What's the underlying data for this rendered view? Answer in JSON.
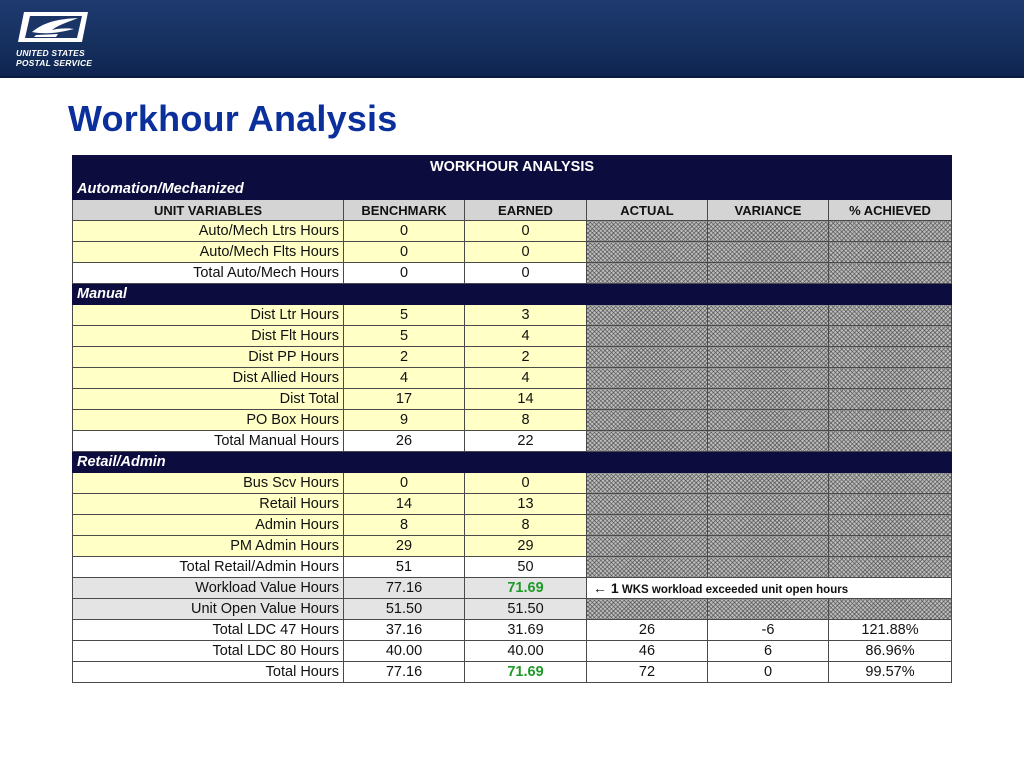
{
  "header": {
    "logo_line1": "UNITED STATES",
    "logo_line2": "POSTAL SERVICE",
    "slide_title": "Workhour Analysis"
  },
  "colors": {
    "banner": "#1a3566",
    "title": "#0b2f9b",
    "table_header": "#0c0c3e",
    "yellow_cell": "#ffffc6",
    "green_value": "#1e9a28"
  },
  "table": {
    "title": "WORKHOUR ANALYSIS",
    "columns": [
      "UNIT VARIABLES",
      "BENCHMARK",
      "EARNED",
      "ACTUAL",
      "VARIANCE",
      "% ACHIEVED"
    ],
    "sections": {
      "auto": "Automation/Mechanized",
      "manual": "Manual",
      "retail": "Retail/Admin"
    },
    "rows": {
      "auto_ltrs": {
        "label": "Auto/Mech Ltrs Hours",
        "benchmark": "0",
        "earned": "0"
      },
      "auto_flts": {
        "label": "Auto/Mech Flts Hours",
        "benchmark": "0",
        "earned": "0"
      },
      "auto_total": {
        "label": "Total Auto/Mech Hours",
        "benchmark": "0",
        "earned": "0"
      },
      "dist_ltr": {
        "label": "Dist Ltr Hours",
        "benchmark": "5",
        "earned": "3"
      },
      "dist_flt": {
        "label": "Dist Flt Hours",
        "benchmark": "5",
        "earned": "4"
      },
      "dist_pp": {
        "label": "Dist PP Hours",
        "benchmark": "2",
        "earned": "2"
      },
      "dist_allied": {
        "label": "Dist Allied Hours",
        "benchmark": "4",
        "earned": "4"
      },
      "dist_total": {
        "label": "Dist Total",
        "benchmark": "17",
        "earned": "14"
      },
      "po_box": {
        "label": "PO Box Hours",
        "benchmark": "9",
        "earned": "8"
      },
      "manual_total": {
        "label": "Total Manual Hours",
        "benchmark": "26",
        "earned": "22"
      },
      "bus_scv": {
        "label": "Bus Scv Hours",
        "benchmark": "0",
        "earned": "0"
      },
      "retail": {
        "label": "Retail Hours",
        "benchmark": "14",
        "earned": "13"
      },
      "admin": {
        "label": "Admin Hours",
        "benchmark": "8",
        "earned": "8"
      },
      "pm_admin": {
        "label": "PM Admin Hours",
        "benchmark": "29",
        "earned": "29"
      },
      "retail_total": {
        "label": "Total Retail/Admin Hours",
        "benchmark": "51",
        "earned": "50"
      },
      "workload": {
        "label": "Workload Value Hours",
        "benchmark": "77.16",
        "earned": "71.69",
        "note_arrow": "← 1",
        "note_text": "WKS workload exceeded unit open hours"
      },
      "open_value": {
        "label": "Unit Open Value Hours",
        "benchmark": "51.50",
        "earned": "51.50"
      },
      "ldc47": {
        "label": "Total LDC 47 Hours",
        "benchmark": "37.16",
        "earned": "31.69",
        "actual": "26",
        "variance": "-6",
        "achieved": "121.88%"
      },
      "ldc80": {
        "label": "Total LDC 80 Hours",
        "benchmark": "40.00",
        "earned": "40.00",
        "actual": "46",
        "variance": "6",
        "achieved": "86.96%"
      },
      "total_hours": {
        "label": "Total Hours",
        "benchmark": "77.16",
        "earned": "71.69",
        "actual": "72",
        "variance": "0",
        "achieved": "99.57%"
      }
    }
  }
}
